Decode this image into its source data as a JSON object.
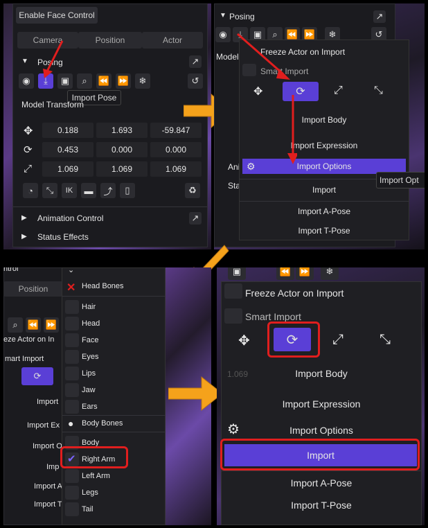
{
  "colors": {
    "accent": "#5a3fd6",
    "highlight": "#e01e1e",
    "orange": "#f5a21b",
    "panel": "#1b1b1f"
  },
  "q1": {
    "enable_face": "Enable Face Control",
    "tabs": [
      "Camera",
      "Position",
      "Actor"
    ],
    "posing": "Posing",
    "tooltip": "Import Pose",
    "model_transform": "Model Transform",
    "rows": [
      [
        "0.188",
        "1.693",
        "-59.847"
      ],
      [
        "0.453",
        "0.000",
        "0.000"
      ],
      [
        "1.069",
        "1.069",
        "1.069"
      ]
    ],
    "ik": "IK",
    "animation_control": "Animation Control",
    "status_effects": "Status Effects"
  },
  "q2": {
    "posing": "Posing",
    "freeze": "Freeze Actor on Import",
    "smart": "Smart Import",
    "model_frag": "Model T",
    "import_body": "Import Body",
    "import_expression": "Import Expression",
    "import_options": "Import Options",
    "import": "Import",
    "import_apose": "Import A-Pose",
    "import_tpose": "Import T-Pose",
    "side_ani": "Ani",
    "side_stat": "Stat",
    "tooltip_frag": "Import Opt"
  },
  "q3": {
    "header_frag": "ntrol",
    "position": "Position",
    "freeze_frag": "eze Actor on In",
    "smart_frag": "mart Import",
    "import_a": "Import",
    "import_ex_frag": "Import Ex",
    "import_o_frag": "Import O",
    "imp_frag": "Imp",
    "import_a_frag": "Import A",
    "import_t_frag": "Import T",
    "head_bones": "Head Bones",
    "head_items": [
      "Hair",
      "Head",
      "Face",
      "Eyes",
      "Lips",
      "Jaw",
      "Ears"
    ],
    "body_bones": "Body Bones",
    "body_items": [
      "Body",
      "Right Arm",
      "Left Arm",
      "Legs",
      "Tail"
    ]
  },
  "q4": {
    "freeze": "Freeze Actor on Import",
    "smart": "Smart Import",
    "import_body": "Import Body",
    "import_expression": "Import Expression",
    "import_options": "Import Options",
    "import": "Import",
    "import_apose": "Import A-Pose",
    "import_tpose": "Import T-Pose",
    "num_frag": "1.069"
  }
}
